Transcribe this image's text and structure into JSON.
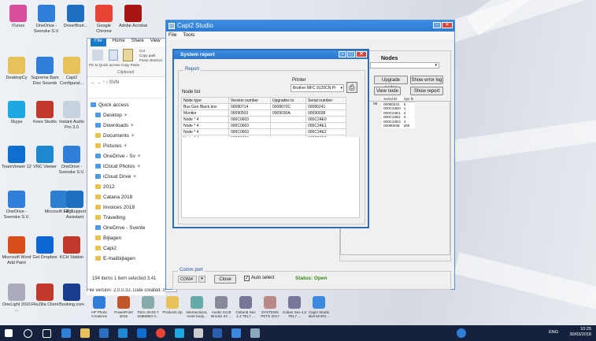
{
  "desktop": {
    "icons_row1": [
      {
        "label": "iTunes",
        "color": "#d94f9b"
      },
      {
        "label": "OneDrive - Svenske S.V.",
        "color": "#2f7fd8"
      },
      {
        "label": "DriverBoot...",
        "color": "#1e6fc2"
      },
      {
        "label": "Google Chrome",
        "color": "#e84335"
      },
      {
        "label": "Adobe Acrobat",
        "color": "#a81515"
      }
    ],
    "icons_col1": [
      {
        "label": "DesktopCy",
        "color": "#e7c15a"
      },
      {
        "label": "Skype",
        "color": "#1ea7e1"
      },
      {
        "label": "TeamViewer 12",
        "color": "#0e6fd1"
      },
      {
        "label": "Microsoft Edge",
        "color": "#2d7fd1"
      },
      {
        "label": "Microsoft Word Add Paint",
        "color": "#d94f1c"
      },
      {
        "label": "OneLight 2016 ...",
        "color": "#aab"
      }
    ],
    "icons_col2": [
      {
        "label": "Supreme Bam Disc Sounds",
        "color": "#2f7fd8"
      },
      {
        "label": "Kees Studio",
        "color": "#c0392b"
      },
      {
        "label": "VNC Viewer",
        "color": "#1e88d0"
      },
      {
        "label": "OneDrive - Svenske S.V.",
        "color": "#2f7fd8"
      },
      {
        "label": "Get Dropbox",
        "color": "#0e66d5"
      },
      {
        "label": "FileZilla Client",
        "color": "#c0392b"
      }
    ],
    "icons_col3": [
      {
        "label": "Capi2 Configurat...",
        "color": "#e7c15a"
      },
      {
        "label": "Instant Audio Pro 3.0",
        "color": "#c7d2de"
      },
      {
        "label": "OneDrive - Svenske S.V.",
        "color": "#2f7fd8"
      },
      {
        "label": "HP Support Assistant",
        "color": "#1e6fc2"
      },
      {
        "label": "KCH Station",
        "color": "#c0392b"
      },
      {
        "label": "Booking.com",
        "color": "#1b3d8f"
      }
    ],
    "bottom_row": [
      "HP Photo Creations",
      "PowerPoint 2016",
      "Totro 18-03-7 1MB3853 3...",
      "Products.zip",
      "Intersections, more body...",
      "Austin Scott Brooks 34 ...",
      "Cultural Sex 4,3 TEL7 ...",
      "SYSTEMS PETS 2017 PA...",
      "Cuban Sex 4,5 TEL7 ...",
      "Capi2 Studio Ball MARS..."
    ]
  },
  "explorer": {
    "tabs": [
      "File",
      "Home",
      "Share",
      "View"
    ],
    "ribbon_labels": [
      "Pin to Quick access",
      "Copy",
      "Paste",
      "Cut",
      "Copy path",
      "Paste shortcut"
    ],
    "clipboard_label": "Clipboard",
    "path": "SVN",
    "nav_items": [
      {
        "label": "Quick access",
        "pin": false,
        "blue": true
      },
      {
        "label": "Desktop",
        "pin": true,
        "blue": true
      },
      {
        "label": "Downloads",
        "pin": true,
        "blue": true
      },
      {
        "label": "Documents",
        "pin": true,
        "blue": false
      },
      {
        "label": "Pictures",
        "pin": true,
        "blue": false
      },
      {
        "label": "OneDrive - Sv",
        "pin": true,
        "blue": true
      },
      {
        "label": "iCloud Photos",
        "pin": true,
        "blue": true
      },
      {
        "label": "iCloud Drive",
        "pin": true,
        "blue": true
      },
      {
        "label": "2012",
        "pin": false,
        "blue": false
      },
      {
        "label": "Catana 2018",
        "pin": false,
        "blue": false
      },
      {
        "label": "Invoices 2018",
        "pin": false,
        "blue": false
      },
      {
        "label": "Travelling",
        "pin": false,
        "blue": false
      },
      {
        "label": "OneDrive - Svente",
        "pin": false,
        "blue": true
      },
      {
        "label": "Bijlagen",
        "pin": false,
        "blue": false
      },
      {
        "label": "Capi2",
        "pin": false,
        "blue": false
      },
      {
        "label": "E-mailbijlagen",
        "pin": false,
        "blue": false
      }
    ],
    "status": "194 items   1 item selected 3.41",
    "file_version": "File version: 2.0.0.32, Date created: 04"
  },
  "capi": {
    "title": "Capi2 Studio",
    "menu": [
      "File",
      "Tools"
    ],
    "nodes_title": "Nodes",
    "buttons": {
      "upgrade": "Upgrade nodes",
      "show_error": "Show error log",
      "view_node": "View node",
      "show_report": "Show report"
    },
    "node_table": {
      "headers": [
        "Serial ID",
        "Sys fir"
      ],
      "rows": [
        [
          "00080241",
          "0"
        ],
        [
          "000C24E0",
          "1"
        ],
        [
          "000C24E1",
          "2"
        ],
        [
          "000C24E2",
          "3"
        ],
        [
          "000C24E3",
          "4"
        ],
        [
          "00090038",
          "255"
        ]
      ],
      "prefix_label": "ox"
    },
    "comm_port": {
      "title": "Comm port",
      "port": "COM4",
      "close_label": "Close",
      "auto_select": "Auto select",
      "status": "Status: Open"
    }
  },
  "report": {
    "title": "System report",
    "group_title": "Report",
    "printer_label": "Printer",
    "printer_value": "Brother MFC 9120CN Pr",
    "node_list_label": "Node list",
    "headers": [
      "Node type",
      "Version number",
      "Upgrades to",
      "Serial number"
    ],
    "rows": [
      [
        "Bus Gen Black box",
        "00080714",
        "0008070C",
        "00080241"
      ],
      [
        "Monitor",
        "00090503",
        "0009030A",
        "00090038"
      ],
      [
        "Node * 4",
        "000C0603",
        "",
        "000C24E0"
      ],
      [
        "Node * 4",
        "000C0603",
        "",
        "000C24E1"
      ],
      [
        "Node * 4",
        "000C0603",
        "",
        "000C24E2"
      ],
      [
        "Node * 4",
        "000C0603",
        "",
        "000C24E3"
      ]
    ]
  },
  "taskbar": {
    "tray_text": "ENG",
    "time": "10:25",
    "date": "30/03/2018"
  }
}
